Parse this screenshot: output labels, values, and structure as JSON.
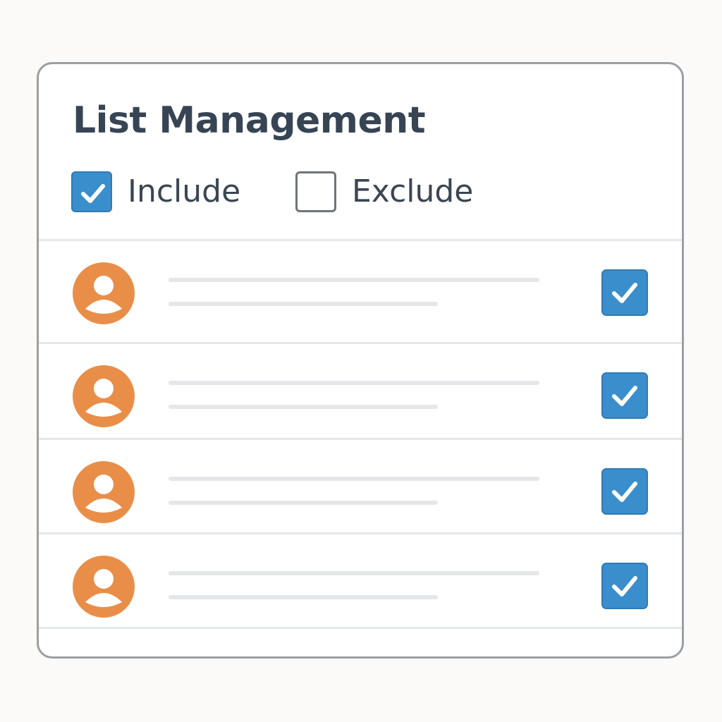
{
  "panel": {
    "title": "List Management"
  },
  "filters": [
    {
      "label": "Include",
      "checked": true
    },
    {
      "label": "Exclude",
      "checked": false
    }
  ],
  "rows": [
    {
      "checked": true,
      "avatar_icon": "user-icon"
    },
    {
      "checked": true,
      "avatar_icon": "user-icon"
    },
    {
      "checked": true,
      "avatar_icon": "user-icon"
    },
    {
      "checked": true,
      "avatar_icon": "user-icon"
    }
  ],
  "colors": {
    "accent": "#3a8ecb",
    "avatar": "#e98e48",
    "title_text": "#374454",
    "placeholder_line": "#e4e6e9",
    "border": "#9c9fa3"
  }
}
